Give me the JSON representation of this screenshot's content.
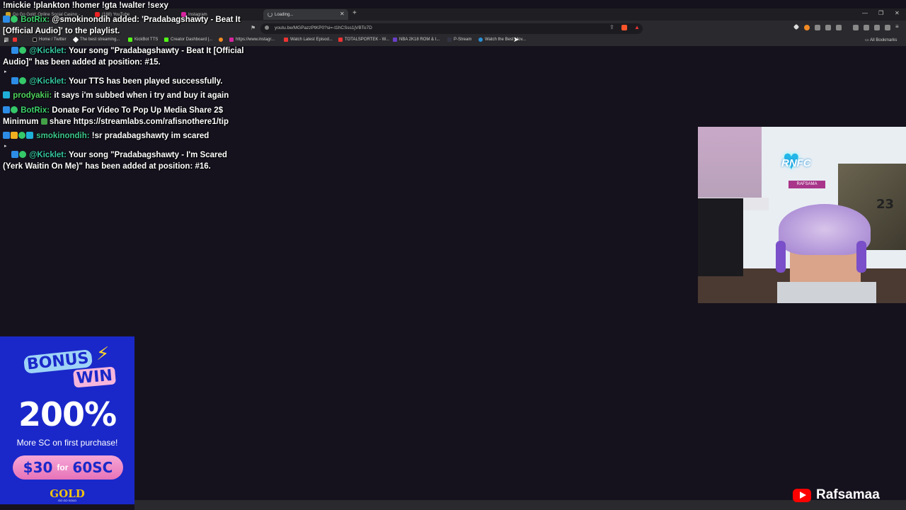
{
  "browser": {
    "tabs": [
      {
        "label": "Go Go Gold: Online Social Casino -"
      },
      {
        "label": "(188) YouTube"
      },
      {
        "label": "Instagram"
      },
      {
        "label": "Loading..."
      }
    ],
    "url": "youtu.be/MGPazzPtKP0?si=-t1hCSss1jVBTo7D",
    "bookmarks": [
      "Home / Twitter",
      "The best streaming...",
      "KickBot TTS",
      "Creator Dashboard |...",
      "https://www.instagr...",
      "Watch Latest Episod...",
      "TOTALSPORTEK - W...",
      "NBA 2K18 ROM & I...",
      "P-Stream",
      "Watch the Best Mov..."
    ],
    "all_bookmarks_label": "All Bookmarks"
  },
  "chat": {
    "header": "!mickie !plankton !homer !gta !walter !sexy",
    "messages": [
      {
        "user": "BotRix:",
        "text": "@smokinondih added: 'Pradabagshawty - Beat It [Official Audio]' to the playlist."
      },
      {
        "user": "@Kicklet:",
        "text": "Your song \"Pradabagshawty - Beat It [Official Audio]\" has been added at position: #15."
      },
      {
        "user": "@Kicklet:",
        "text": "Your TTS has been played successfully."
      },
      {
        "user": "prodyakii:",
        "text": "it says i'm subbed when i try and buy it again"
      },
      {
        "user": "BotRix:",
        "text": "Donate For Video To Pop Up Media Share 2$ Minimum",
        "text2": "share https://streamlabs.com/rafisnothere1/tip"
      },
      {
        "user": "smokinondih:",
        "text": "!sr pradabagshawty im scared"
      },
      {
        "user": "@Kicklet:",
        "text": "Your song \"Pradabagshawty - I'm Scared (Yerk Waitin On Me)\" has been added at position: #16."
      }
    ]
  },
  "webcam": {
    "logo": "RNFC",
    "name_tag": "RAFSAMA",
    "jersey_number": "23"
  },
  "ad": {
    "bonus": "BONUS",
    "win": "WIN",
    "percent": "200%",
    "subtitle": "More SC on first purchase!",
    "price": "$30",
    "for": "for",
    "amount": "60SC",
    "brand": "GOLD",
    "brand_sub": "GO GO GOLD"
  },
  "channel": {
    "name": "Rafsamaa"
  }
}
